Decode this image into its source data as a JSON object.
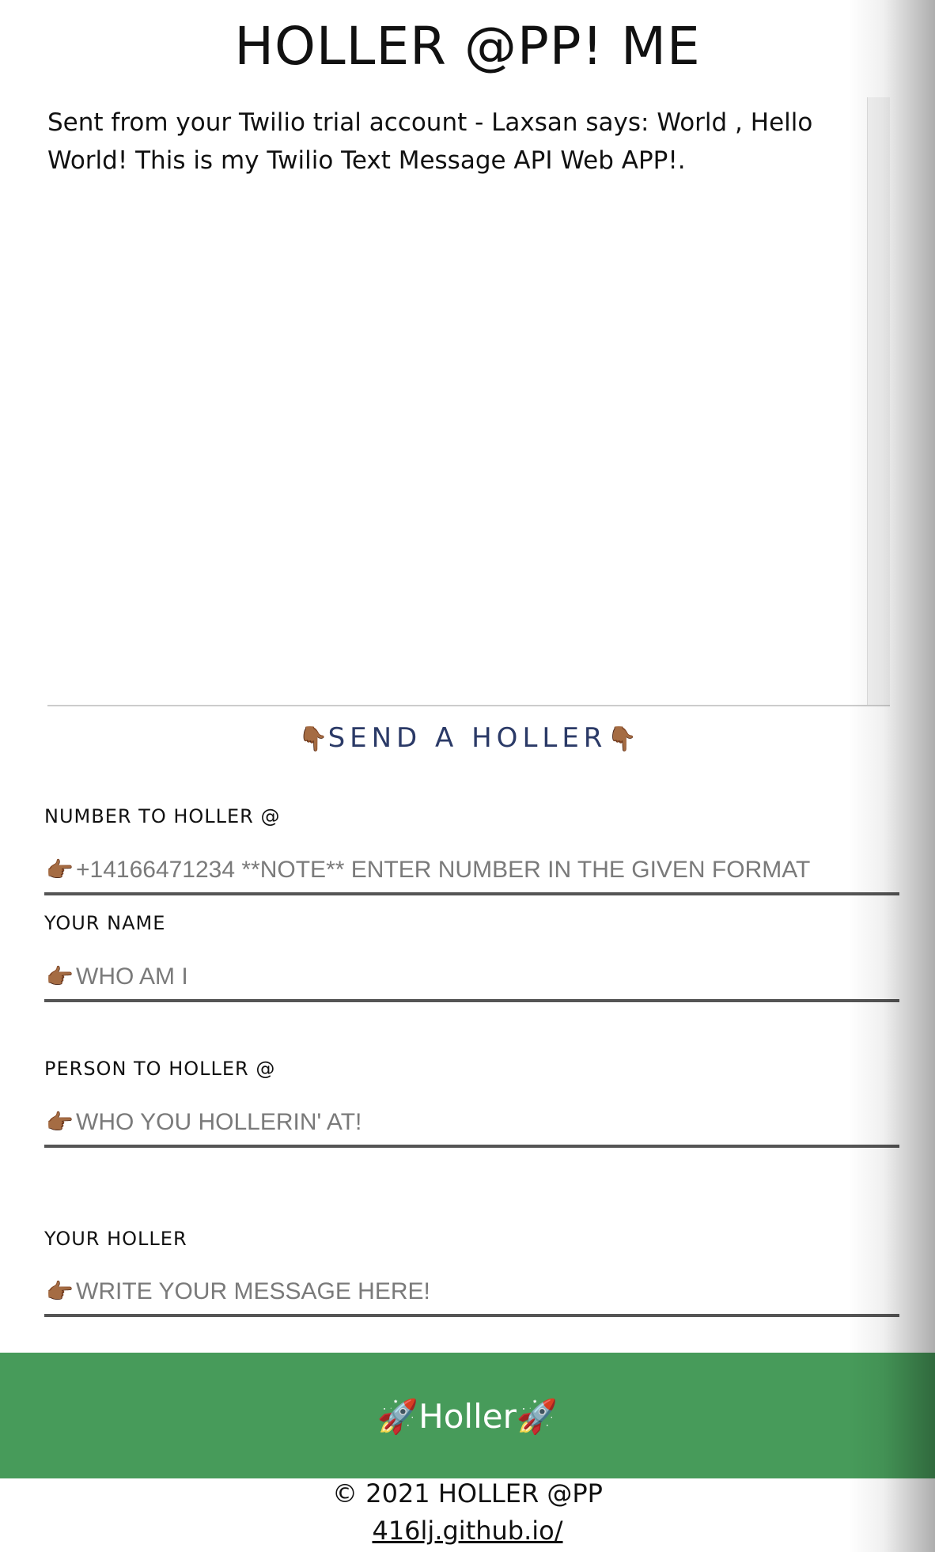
{
  "app": {
    "title": "HOLLER @PP! ME"
  },
  "message_log": {
    "text": "Sent from your Twilio trial account - Laxsan says: World , Hello World! This is my Twilio Text Message API Web APP!."
  },
  "send_section": {
    "heading": "SEND A HOLLER",
    "hand_glyph": "👇🏾"
  },
  "form": {
    "hand_glyph": "👉🏾",
    "number": {
      "label": "NUMBER TO HOLLER @",
      "placeholder": "+14166471234 **NOTE** ENTER NUMBER IN THE GIVEN FORMAT",
      "value": ""
    },
    "name": {
      "label": "YOUR NAME",
      "placeholder": "WHO AM I",
      "value": ""
    },
    "person": {
      "label": "PERSON TO HOLLER @",
      "placeholder": "WHO YOU HOLLERIN' AT!",
      "value": ""
    },
    "message": {
      "label": "YOUR HOLLER",
      "placeholder": "WRITE YOUR MESSAGE HERE!",
      "value": ""
    },
    "submit": {
      "label": "Holler",
      "icon_glyph": "🚀",
      "color": "#479b5a"
    }
  },
  "footer": {
    "copyright": "© 2021 HOLLER @PP",
    "link_text": "416lj.github.io/"
  },
  "colors": {
    "heading_accent": "#2b3a67",
    "button_green": "#479b5a"
  }
}
